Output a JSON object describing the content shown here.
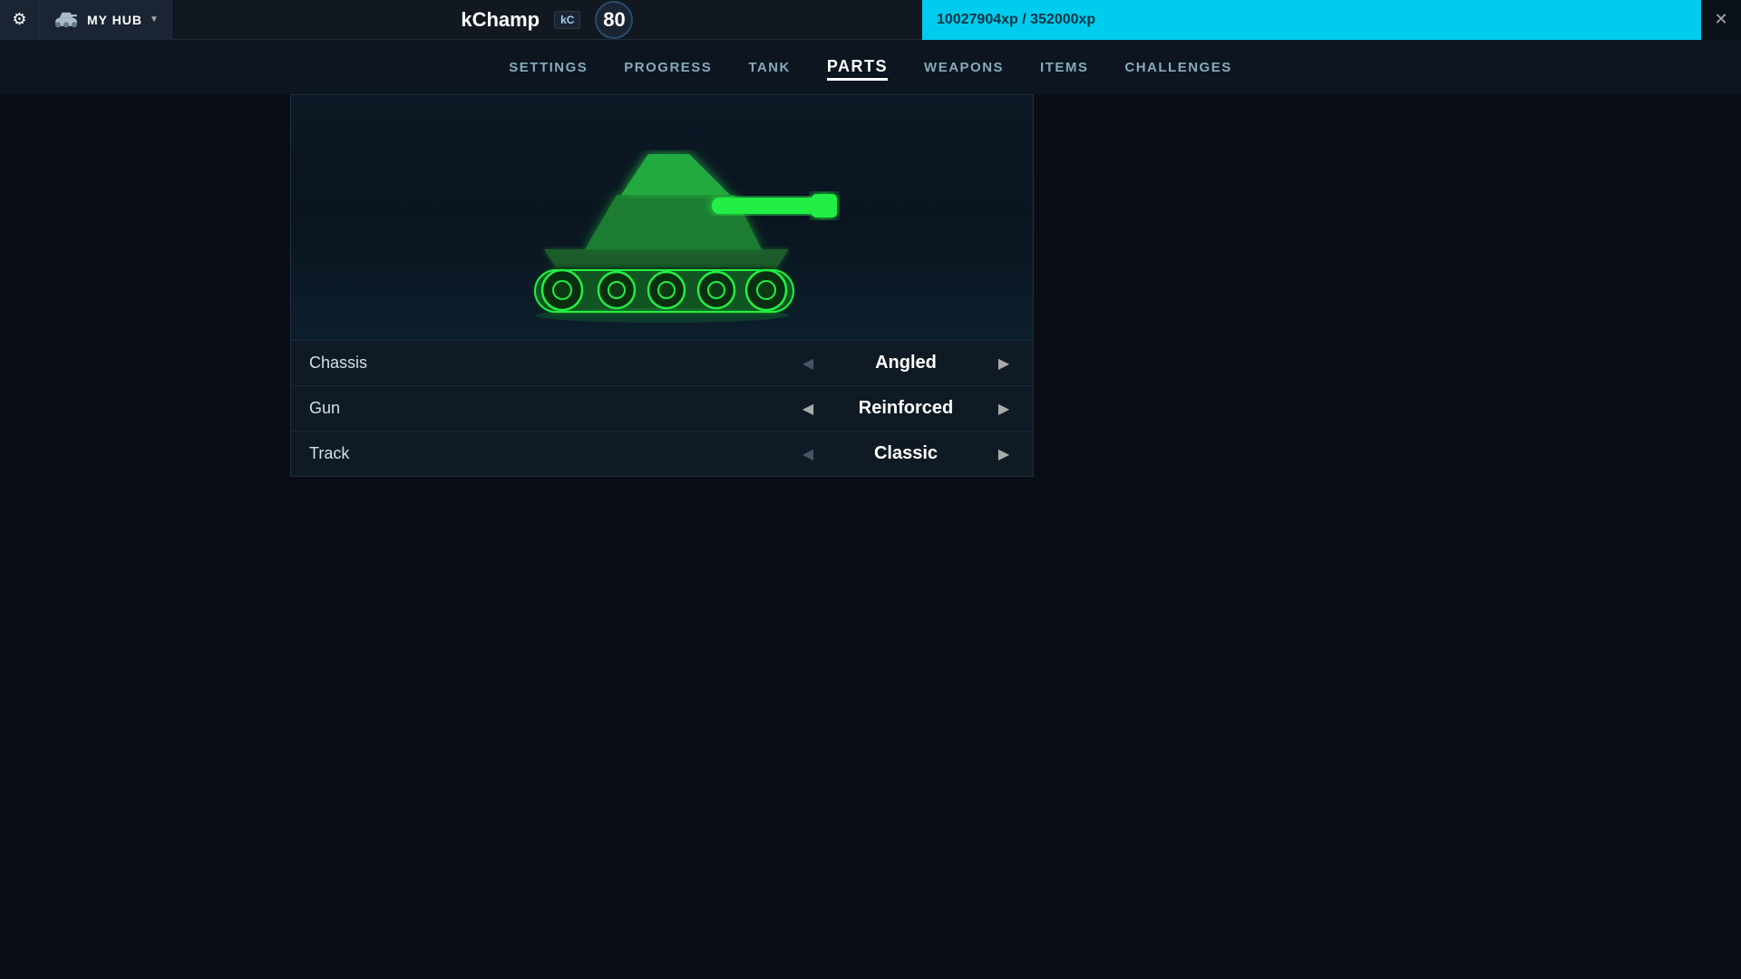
{
  "topbar": {
    "settings_icon": "⚙",
    "hub_label": "MY HUB",
    "chevron": "▼",
    "username": "kChamp",
    "username_badge": "kC",
    "level": "80",
    "xp_current": "10027904xp",
    "xp_required": "352000xp",
    "xp_display": "10027904xp / 352000xp",
    "close_icon": "✕"
  },
  "nav": {
    "items": [
      {
        "label": "SETTINGS",
        "active": false
      },
      {
        "label": "PROGRESS",
        "active": false
      },
      {
        "label": "TANK",
        "active": false
      },
      {
        "label": "PARTS",
        "active": true
      },
      {
        "label": "WEAPONS",
        "active": false
      },
      {
        "label": "ITEMS",
        "active": false
      },
      {
        "label": "CHALLENGES",
        "active": false
      }
    ]
  },
  "parts": {
    "rows": [
      {
        "name": "Chassis",
        "value": "Angled",
        "has_prev": false,
        "has_next": true
      },
      {
        "name": "Gun",
        "value": "Reinforced",
        "has_prev": true,
        "has_next": true
      },
      {
        "name": "Track",
        "value": "Classic",
        "has_prev": false,
        "has_next": true
      }
    ]
  },
  "colors": {
    "tank_green": "#22ee44",
    "accent_cyan": "#00ccee",
    "bg_dark": "#0a0e14",
    "bg_panel": "#0f1a24"
  }
}
